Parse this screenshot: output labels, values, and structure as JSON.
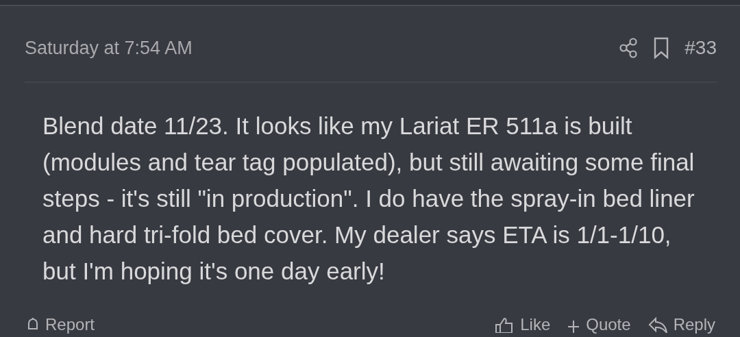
{
  "post": {
    "date": "Saturday at 7:54 AM",
    "number": "#33",
    "body": "Blend date 11/23. It looks like my Lariat ER 511a is built (modules and tear tag populated), but still awaiting some final steps - it's still \"in production\". I do have the spray-in bed liner and hard tri-fold bed cover. My dealer says ETA is 1/1-1/10, but I'm hoping it's one day early!"
  },
  "actions_left": [
    {
      "kind": "report",
      "label": "Report"
    }
  ],
  "actions_right": [
    {
      "kind": "like",
      "label": "Like"
    },
    {
      "kind": "quote",
      "label": "Quote"
    },
    {
      "kind": "reply",
      "label": "Reply"
    }
  ]
}
